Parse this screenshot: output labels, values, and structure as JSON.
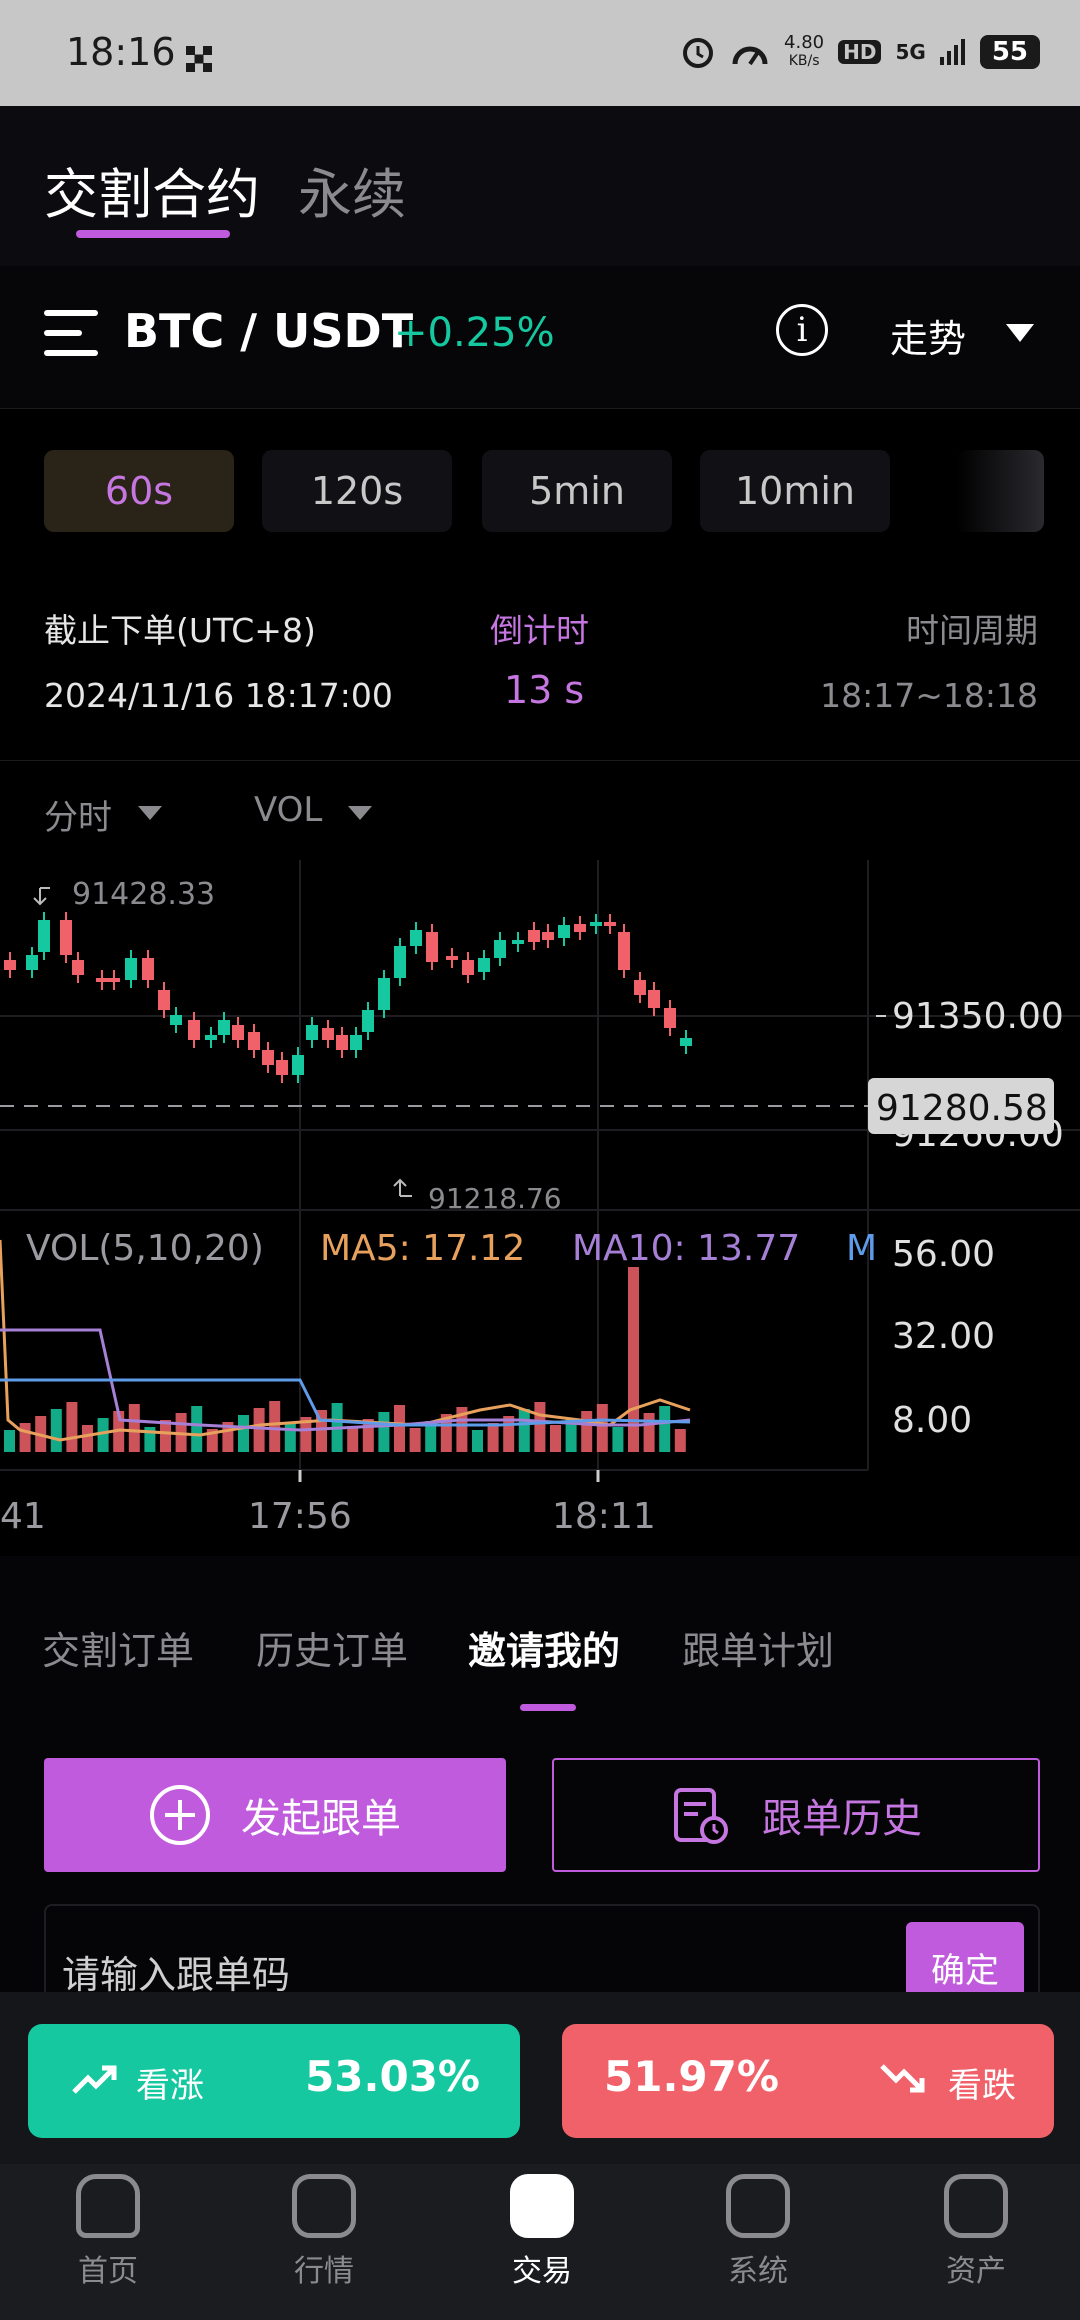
{
  "status": {
    "time": "18:16",
    "speed": "4.80",
    "speed_unit": "KB/s",
    "hd": "HD",
    "net": "5G",
    "battery": "55"
  },
  "tabs": {
    "delivery": "交割合约",
    "perpetual": "永续"
  },
  "pair": {
    "name": "BTC / USDT",
    "change": "+0.25%",
    "info": "i",
    "trend_label": "走势"
  },
  "intervals": [
    {
      "label": "60s"
    },
    {
      "label": "120s"
    },
    {
      "label": "5min"
    },
    {
      "label": "10min"
    }
  ],
  "order_info": {
    "deadline_label": "截止下单(UTC+8)",
    "deadline_value": "2024/11/16 18:17:00",
    "countdown_label": "倒计时",
    "countdown_value": "13 s",
    "period_label": "时间周期",
    "period_value": "18:17~18:18"
  },
  "chart_controls": {
    "mode": "分时",
    "indicator": "VOL"
  },
  "chart_data": {
    "type": "candlestick",
    "price_high_label": "91428.33",
    "price_low_label": "91218.76",
    "current_price": "91280.58",
    "y_ticks": [
      "91350.00",
      "91260.00"
    ],
    "vol_label": "VOL(5,10,20)",
    "ma5": "MA5: 17.12",
    "ma10": "MA10: 13.77",
    "ma20_cut": "M",
    "vol_ticks": [
      "56.00",
      "32.00",
      "8.00"
    ],
    "x_ticks": [
      "41",
      "17:56",
      "18:11"
    ]
  },
  "order_tabs": [
    {
      "label": "交割订单"
    },
    {
      "label": "历史订单"
    },
    {
      "label": "邀请我的"
    },
    {
      "label": "跟单计划"
    }
  ],
  "copy": {
    "start_button": "发起跟单",
    "history_button": "跟单历史",
    "input_placeholder": "请输入跟单码",
    "confirm": "确定"
  },
  "trade": {
    "up_label": "看涨",
    "up_percent": "53.03%",
    "down_percent": "51.97%",
    "down_label": "看跌"
  },
  "nav": [
    {
      "label": "首页"
    },
    {
      "label": "行情"
    },
    {
      "label": "交易"
    },
    {
      "label": "系统"
    },
    {
      "label": "资产"
    }
  ],
  "colors": {
    "accent": "#c15bdd",
    "up": "#16c8a0",
    "down": "#f0616a"
  }
}
